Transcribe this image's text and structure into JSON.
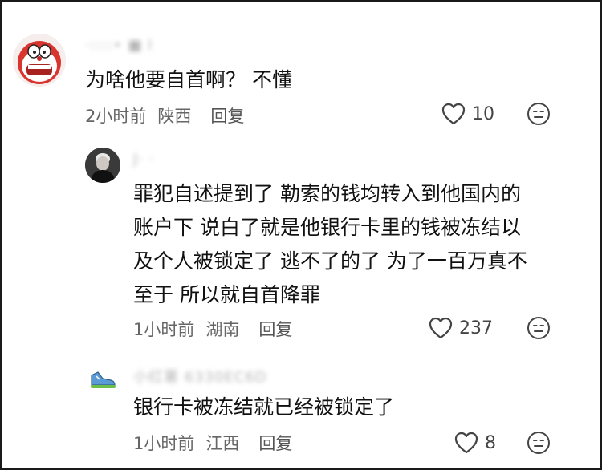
{
  "comments": [
    {
      "username": "·::::• ■ I",
      "text": "为啥他要自首啊？ 不懂",
      "time": "2小时前",
      "location": "陕西",
      "reply_label": "回复",
      "likes": "10"
    },
    {
      "username": "J· ·",
      "text": "罪犯自述提到了 勒索的钱均转入到他国内的\n账户下 说白了就是他银行卡里的钱被冻结以\n及个人被锁定了 逃不了的了 为了一百万真不\n至于 所以就自首降罪",
      "time": "1小时前",
      "location": "湖南",
      "reply_label": "回复",
      "likes": "237"
    },
    {
      "username": "小红薯 6330EC6D",
      "text": "银行卡被冻结就已经被锁定了",
      "time": "1小时前",
      "location": "江西",
      "reply_label": "回复",
      "likes": "8"
    }
  ],
  "icons": {
    "like": "heart-outline-icon",
    "emoji": "neutral-face-icon"
  },
  "colors": {
    "text": "#111111",
    "meta": "#666666",
    "icon": "#444444"
  }
}
